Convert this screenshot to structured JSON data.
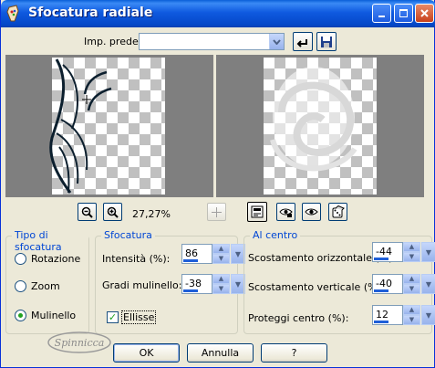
{
  "window": {
    "title": "Sfocatura radiale"
  },
  "preset": {
    "label": "Imp. predef.:",
    "value": ""
  },
  "zoom": {
    "level": "27,27%"
  },
  "groups": {
    "tipo": {
      "legend": "Tipo di sfocatura",
      "options": [
        {
          "label": "Rotazione",
          "selected": false
        },
        {
          "label": "Zoom",
          "selected": false
        },
        {
          "label": "Mulinello",
          "selected": true
        }
      ]
    },
    "sfocatura": {
      "legend": "Sfocatura",
      "intensita": {
        "label": "Intensità (%):",
        "value": "86"
      },
      "gradi": {
        "label": "Gradi mulinello:",
        "value": "-38"
      },
      "ellisse": {
        "label": "Ellisse",
        "checked": true
      }
    },
    "centro": {
      "legend": "Al centro",
      "orizz": {
        "label": "Scostamento orizzontale (%):",
        "value": "-44"
      },
      "vert": {
        "label": "Scostamento verticale (%):",
        "value": "-40"
      },
      "proteggi": {
        "label": "Proteggi centro (%):",
        "value": "12"
      }
    }
  },
  "buttons": {
    "ok": "OK",
    "cancel": "Annulla",
    "help": "?"
  },
  "watermark": {
    "text": "Spinnicca"
  },
  "icons": {
    "app": "paint-shop-icon",
    "zoom_out": "zoom-out-icon",
    "zoom_in": "zoom-in-icon",
    "pan": "move-icon",
    "proof": "proof-icon",
    "randomize": "dice-icon"
  },
  "colors": {
    "titlebar": "#0a5fd8",
    "accent": "#0046d5",
    "face": "#ece9d8"
  }
}
